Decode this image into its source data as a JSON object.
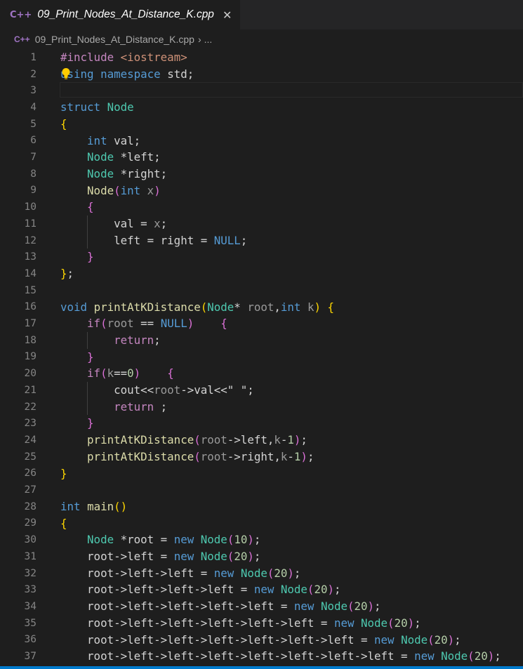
{
  "tab": {
    "title": "09_Print_Nodes_At_Distance_K.cpp",
    "icon": "C++",
    "close_symbol": "✕"
  },
  "breadcrumb": {
    "icon": "C++",
    "file": "09_Print_Nodes_At_Distance_K.cpp",
    "separator": "›",
    "more": "..."
  },
  "editor": {
    "current_line": 3,
    "lines": [
      {
        "n": "1",
        "tokens": [
          [
            "pre",
            "#include "
          ],
          [
            "inc",
            "<iostream>"
          ]
        ]
      },
      {
        "n": "2",
        "tokens": [
          [
            "kw",
            "using"
          ],
          [
            "pl",
            " "
          ],
          [
            "kw",
            "namespace"
          ],
          [
            "pl",
            " std;"
          ]
        ]
      },
      {
        "n": "3",
        "tokens": []
      },
      {
        "n": "4",
        "tokens": [
          [
            "kw",
            "struct"
          ],
          [
            "pl",
            " "
          ],
          [
            "type",
            "Node"
          ]
        ]
      },
      {
        "n": "5",
        "tokens": [
          [
            "b1",
            "{"
          ]
        ]
      },
      {
        "n": "6",
        "tokens": [
          [
            "pl",
            "    "
          ],
          [
            "kw",
            "int"
          ],
          [
            "pl",
            " val;"
          ]
        ]
      },
      {
        "n": "7",
        "tokens": [
          [
            "pl",
            "    "
          ],
          [
            "type",
            "Node"
          ],
          [
            "pl",
            " *left;"
          ]
        ]
      },
      {
        "n": "8",
        "tokens": [
          [
            "pl",
            "    "
          ],
          [
            "type",
            "Node"
          ],
          [
            "pl",
            " *right;"
          ]
        ]
      },
      {
        "n": "9",
        "tokens": [
          [
            "pl",
            "    "
          ],
          [
            "fn",
            "Node"
          ],
          [
            "b2",
            "("
          ],
          [
            "kw",
            "int"
          ],
          [
            "pl",
            " "
          ],
          [
            "dim",
            "x"
          ],
          [
            "b2",
            ")"
          ]
        ]
      },
      {
        "n": "10",
        "tokens": [
          [
            "pl",
            "    "
          ],
          [
            "b2",
            "{"
          ]
        ]
      },
      {
        "n": "11",
        "tokens": [
          [
            "pl",
            "        val = "
          ],
          [
            "dim",
            "x"
          ],
          [
            "pl",
            ";"
          ]
        ]
      },
      {
        "n": "12",
        "tokens": [
          [
            "pl",
            "        left = right = "
          ],
          [
            "kw",
            "NULL"
          ],
          [
            "pl",
            ";"
          ]
        ]
      },
      {
        "n": "13",
        "tokens": [
          [
            "pl",
            "    "
          ],
          [
            "b2",
            "}"
          ]
        ]
      },
      {
        "n": "14",
        "tokens": [
          [
            "b1",
            "}"
          ],
          [
            "pl",
            ";"
          ]
        ]
      },
      {
        "n": "15",
        "tokens": []
      },
      {
        "n": "16",
        "tokens": [
          [
            "kw",
            "void"
          ],
          [
            "pl",
            " "
          ],
          [
            "fn",
            "printAtKDistance"
          ],
          [
            "b1",
            "("
          ],
          [
            "type",
            "Node"
          ],
          [
            "pl",
            "* "
          ],
          [
            "dim",
            "root"
          ],
          [
            "pl",
            ","
          ],
          [
            "kw",
            "int"
          ],
          [
            "pl",
            " "
          ],
          [
            "dim",
            "k"
          ],
          [
            "b1",
            ")"
          ],
          [
            "pl",
            " "
          ],
          [
            "b1",
            "{"
          ]
        ]
      },
      {
        "n": "17",
        "tokens": [
          [
            "pl",
            "    "
          ],
          [
            "ctrl",
            "if"
          ],
          [
            "b2",
            "("
          ],
          [
            "dim",
            "root"
          ],
          [
            "pl",
            " == "
          ],
          [
            "kw",
            "NULL"
          ],
          [
            "b2",
            ")"
          ],
          [
            "pl",
            "    "
          ],
          [
            "b2",
            "{"
          ]
        ]
      },
      {
        "n": "18",
        "tokens": [
          [
            "pl",
            "        "
          ],
          [
            "ctrl",
            "return"
          ],
          [
            "pl",
            ";"
          ]
        ]
      },
      {
        "n": "19",
        "tokens": [
          [
            "pl",
            "    "
          ],
          [
            "b2",
            "}"
          ]
        ]
      },
      {
        "n": "20",
        "tokens": [
          [
            "pl",
            "    "
          ],
          [
            "ctrl",
            "if"
          ],
          [
            "b2",
            "("
          ],
          [
            "dim",
            "k"
          ],
          [
            "pl",
            "=="
          ],
          [
            "num",
            "0"
          ],
          [
            "b2",
            ")"
          ],
          [
            "pl",
            "    "
          ],
          [
            "b2",
            "{"
          ]
        ]
      },
      {
        "n": "21",
        "tokens": [
          [
            "pl",
            "        cout<<"
          ],
          [
            "dim",
            "root"
          ],
          [
            "pl",
            "->val<<\" \";"
          ]
        ]
      },
      {
        "n": "22",
        "tokens": [
          [
            "pl",
            "        "
          ],
          [
            "ctrl",
            "return"
          ],
          [
            "pl",
            " ;"
          ]
        ]
      },
      {
        "n": "23",
        "tokens": [
          [
            "pl",
            "    "
          ],
          [
            "b2",
            "}"
          ]
        ]
      },
      {
        "n": "24",
        "tokens": [
          [
            "pl",
            "    "
          ],
          [
            "fn",
            "printAtKDistance"
          ],
          [
            "b2",
            "("
          ],
          [
            "dim",
            "root"
          ],
          [
            "pl",
            "->left,"
          ],
          [
            "dim",
            "k"
          ],
          [
            "pl",
            "-"
          ],
          [
            "num",
            "1"
          ],
          [
            "b2",
            ")"
          ],
          [
            "pl",
            ";"
          ]
        ]
      },
      {
        "n": "25",
        "tokens": [
          [
            "pl",
            "    "
          ],
          [
            "fn",
            "printAtKDistance"
          ],
          [
            "b2",
            "("
          ],
          [
            "dim",
            "root"
          ],
          [
            "pl",
            "->right,"
          ],
          [
            "dim",
            "k"
          ],
          [
            "pl",
            "-"
          ],
          [
            "num",
            "1"
          ],
          [
            "b2",
            ")"
          ],
          [
            "pl",
            ";"
          ]
        ]
      },
      {
        "n": "26",
        "tokens": [
          [
            "b1",
            "}"
          ]
        ]
      },
      {
        "n": "27",
        "tokens": []
      },
      {
        "n": "28",
        "tokens": [
          [
            "kw",
            "int"
          ],
          [
            "pl",
            " "
          ],
          [
            "fn",
            "main"
          ],
          [
            "b1",
            "()"
          ]
        ]
      },
      {
        "n": "29",
        "tokens": [
          [
            "b1",
            "{"
          ]
        ]
      },
      {
        "n": "30",
        "tokens": [
          [
            "pl",
            "    "
          ],
          [
            "type",
            "Node"
          ],
          [
            "pl",
            " *root = "
          ],
          [
            "kw",
            "new"
          ],
          [
            "pl",
            " "
          ],
          [
            "type",
            "Node"
          ],
          [
            "b2",
            "("
          ],
          [
            "num",
            "10"
          ],
          [
            "b2",
            ")"
          ],
          [
            "pl",
            ";"
          ]
        ]
      },
      {
        "n": "31",
        "tokens": [
          [
            "pl",
            "    root->left = "
          ],
          [
            "kw",
            "new"
          ],
          [
            "pl",
            " "
          ],
          [
            "type",
            "Node"
          ],
          [
            "b2",
            "("
          ],
          [
            "num",
            "20"
          ],
          [
            "b2",
            ")"
          ],
          [
            "pl",
            ";"
          ]
        ]
      },
      {
        "n": "32",
        "tokens": [
          [
            "pl",
            "    root->left->left = "
          ],
          [
            "kw",
            "new"
          ],
          [
            "pl",
            " "
          ],
          [
            "type",
            "Node"
          ],
          [
            "b2",
            "("
          ],
          [
            "num",
            "20"
          ],
          [
            "b2",
            ")"
          ],
          [
            "pl",
            ";"
          ]
        ]
      },
      {
        "n": "33",
        "tokens": [
          [
            "pl",
            "    root->left->left->left = "
          ],
          [
            "kw",
            "new"
          ],
          [
            "pl",
            " "
          ],
          [
            "type",
            "Node"
          ],
          [
            "b2",
            "("
          ],
          [
            "num",
            "20"
          ],
          [
            "b2",
            ")"
          ],
          [
            "pl",
            ";"
          ]
        ]
      },
      {
        "n": "34",
        "tokens": [
          [
            "pl",
            "    root->left->left->left->left = "
          ],
          [
            "kw",
            "new"
          ],
          [
            "pl",
            " "
          ],
          [
            "type",
            "Node"
          ],
          [
            "b2",
            "("
          ],
          [
            "num",
            "20"
          ],
          [
            "b2",
            ")"
          ],
          [
            "pl",
            ";"
          ]
        ]
      },
      {
        "n": "35",
        "tokens": [
          [
            "pl",
            "    root->left->left->left->left->left = "
          ],
          [
            "kw",
            "new"
          ],
          [
            "pl",
            " "
          ],
          [
            "type",
            "Node"
          ],
          [
            "b2",
            "("
          ],
          [
            "num",
            "20"
          ],
          [
            "b2",
            ")"
          ],
          [
            "pl",
            ";"
          ]
        ]
      },
      {
        "n": "36",
        "tokens": [
          [
            "pl",
            "    root->left->left->left->left->left->left = "
          ],
          [
            "kw",
            "new"
          ],
          [
            "pl",
            " "
          ],
          [
            "type",
            "Node"
          ],
          [
            "b2",
            "("
          ],
          [
            "num",
            "20"
          ],
          [
            "b2",
            ")"
          ],
          [
            "pl",
            ";"
          ]
        ]
      },
      {
        "n": "37",
        "tokens": [
          [
            "pl",
            "    root->left->left->left->left->left->left->left = "
          ],
          [
            "kw",
            "new"
          ],
          [
            "pl",
            " "
          ],
          [
            "type",
            "Node"
          ],
          [
            "b2",
            "("
          ],
          [
            "num",
            "20"
          ],
          [
            "b2",
            ")"
          ],
          [
            "pl",
            ";"
          ]
        ]
      }
    ]
  },
  "colors": {
    "background": "#1e1e1e",
    "keyword": "#569cd6",
    "control": "#c586c0",
    "type": "#4ec9b0",
    "function": "#dcdcaa",
    "number": "#b5cea8",
    "string": "#ce9178",
    "status_bar": "#007acc"
  }
}
